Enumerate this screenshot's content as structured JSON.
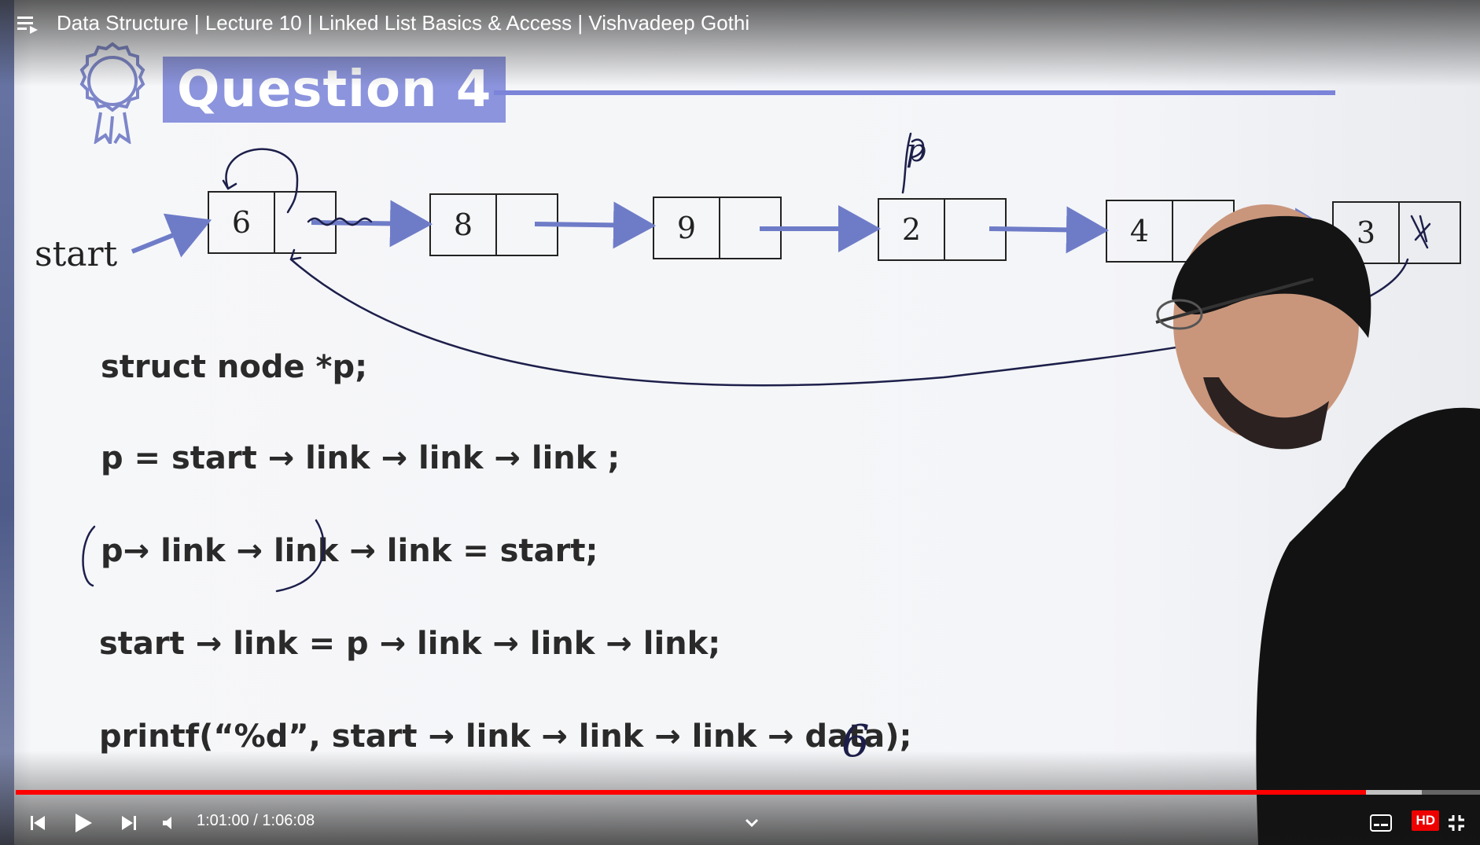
{
  "player": {
    "title": "Data Structure | Lecture 10 | Linked List Basics & Access | Vishvadeep Gothi",
    "time_display": "1:01:00 / 1:06:08",
    "progress_fraction": 0.922,
    "buffer_fraction": 0.96,
    "hd_label": "HD",
    "accent_color": "#ff0000"
  },
  "slide": {
    "heading": "Question 4",
    "start_label": "start",
    "pointer_label": "p",
    "nodes": [
      {
        "data": "6"
      },
      {
        "data": "8"
      },
      {
        "data": "9"
      },
      {
        "data": "2"
      },
      {
        "data": "4"
      },
      {
        "data": "3"
      }
    ],
    "code": [
      "struct node *p;",
      "p = start → link → link → link ;",
      "p→ link → link → link = start;",
      "start → link =  p → link → link → link;",
      "printf(“%d”, start → link → link → link → data);"
    ],
    "handwritten_answer": "6",
    "banner_color": "#8b94dd",
    "arrow_color": "#6e7cc8"
  },
  "icons": {
    "playlist": "playlist-icon",
    "badge": "award-badge-icon",
    "previous": "skip-previous-icon",
    "play": "play-icon",
    "next": "skip-next-icon",
    "volume": "volume-icon",
    "chevron": "chevron-down-icon",
    "subtitles": "subtitles-icon",
    "exit_fullscreen": "exit-fullscreen-icon"
  }
}
